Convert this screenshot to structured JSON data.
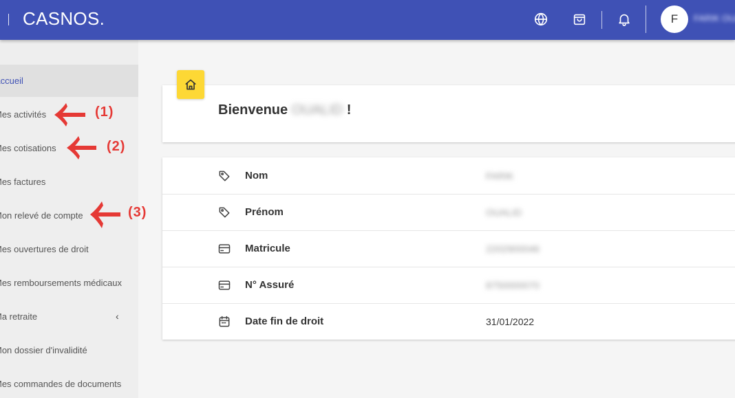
{
  "header": {
    "brand": "CASNOS.",
    "avatar_initial": "F",
    "user_name": "FARIK OUALID"
  },
  "icons": {
    "language": "globe-icon",
    "cart": "shopping-bag-icon",
    "notifications": "bell-icon",
    "home": "home-icon",
    "tag": "tag-icon",
    "card": "credit-card-icon",
    "calendar": "calendar-icon"
  },
  "colors": {
    "primary": "#3f51b5",
    "accent": "#fdd835",
    "annotation": "#e53935"
  },
  "sidebar": {
    "items": [
      {
        "label": "Accueil"
      },
      {
        "label": "Mes activités"
      },
      {
        "label": "Mes cotisations"
      },
      {
        "label": "Mes factures"
      },
      {
        "label": "Mon relevé de compte"
      },
      {
        "label": "Mes ouvertures de droit"
      },
      {
        "label": "Mes remboursements médicaux"
      },
      {
        "label": "Ma retraite",
        "chevron": "‹"
      },
      {
        "label": "Mon dossier d'invalidité"
      },
      {
        "label": "Mes commandes de documents"
      }
    ]
  },
  "annotations": [
    "(1)",
    "(2)",
    "(3)"
  ],
  "welcome": {
    "greeting": "Bienvenue",
    "name": "OUALID",
    "suffix": "!"
  },
  "info": {
    "rows": [
      {
        "label": "Nom",
        "value": "FARIK"
      },
      {
        "label": "Prénom",
        "value": "OUALID"
      },
      {
        "label": "Matricule",
        "value": "2202900046"
      },
      {
        "label": "N° Assuré",
        "value": "8750000070"
      },
      {
        "label": "Date fin de droit",
        "value": "31/01/2022"
      }
    ]
  }
}
